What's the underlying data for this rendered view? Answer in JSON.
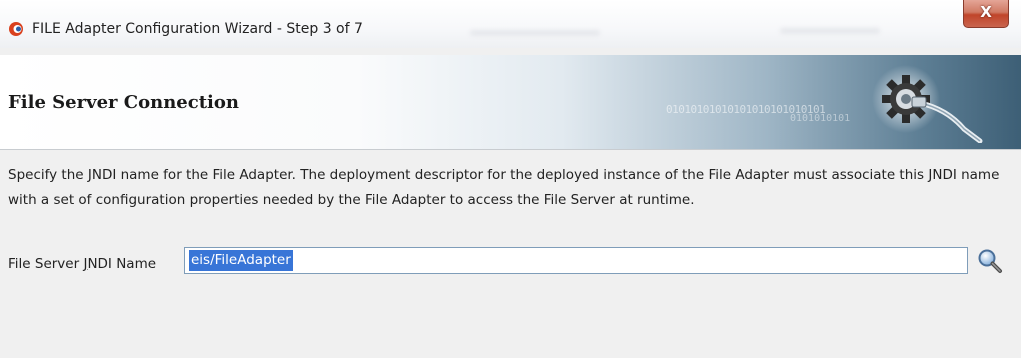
{
  "window": {
    "title": "FILE Adapter Configuration Wizard - Step 3 of 7",
    "close_label": "X"
  },
  "header": {
    "title": "File Server Connection",
    "binary_decoration": "01010101010101010101010101",
    "binary_decoration_2": "0101010101"
  },
  "main": {
    "description": "Specify the JNDI name for the File Adapter. The deployment descriptor for the deployed instance of the File Adapter must associate this JNDI name with a set of configuration properties needed by the File Adapter to access the File Server at runtime.",
    "jndi_field": {
      "label_before": "File Server ",
      "label_mnemonic": "J",
      "label_after": "NDI Name",
      "value": "eis/FileAdapter",
      "value_selected": true
    },
    "search_button_icon": "magnifier-icon"
  },
  "colors": {
    "selection": "#3875d7",
    "close_button": "#c0452a",
    "header_gradient_end": "#3d5f76"
  }
}
